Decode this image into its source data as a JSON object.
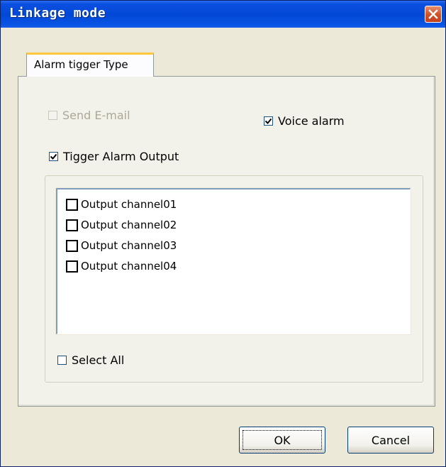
{
  "window": {
    "title": "Linkage mode",
    "close_icon": "close-icon"
  },
  "tabs": [
    {
      "label": "Alarm tigger Type",
      "selected": true
    }
  ],
  "options": {
    "send_email": {
      "label": "Send E-mail",
      "checked": false,
      "enabled": false
    },
    "voice_alarm": {
      "label": "Voice alarm",
      "checked": true,
      "enabled": true
    },
    "trigger_alarm_output": {
      "label": "Tigger Alarm Output",
      "checked": true,
      "enabled": true
    }
  },
  "output_channels": [
    {
      "label": "Output channel01",
      "checked": false
    },
    {
      "label": "Output channel02",
      "checked": false
    },
    {
      "label": "Output channel03",
      "checked": false
    },
    {
      "label": "Output channel04",
      "checked": false
    }
  ],
  "select_all": {
    "label": "Select All",
    "checked": false
  },
  "buttons": {
    "ok": "OK",
    "cancel": "Cancel"
  },
  "colors": {
    "titlebar": "#0248d6",
    "dialog_bg": "#ece9d8",
    "tab_accent": "#ffc83c",
    "close_button": "#d14e25"
  }
}
